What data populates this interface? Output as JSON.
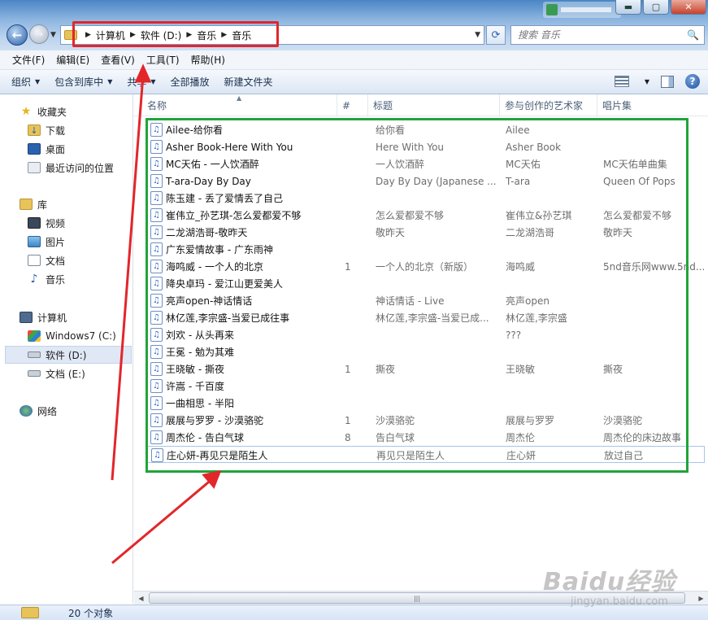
{
  "address_bar": {
    "crumbs": [
      "计算机",
      "软件 (D:)",
      "音乐",
      "音乐"
    ]
  },
  "search": {
    "placeholder": "搜索 音乐"
  },
  "menu": [
    "文件(F)",
    "编辑(E)",
    "查看(V)",
    "工具(T)",
    "帮助(H)"
  ],
  "toolbar": {
    "organize": "组织",
    "include_library": "包含到库中",
    "share": "共享",
    "play_all": "全部播放",
    "new_folder": "新建文件夹"
  },
  "nav": {
    "favorites": "收藏夹",
    "downloads": "下载",
    "desktop": "桌面",
    "recent": "最近访问的位置",
    "libraries": "库",
    "videos": "视频",
    "pictures": "图片",
    "documents": "文档",
    "music": "音乐",
    "computer": "计算机",
    "drive_c": "Windows7 (C:)",
    "drive_d": "软件 (D:)",
    "drive_e": "文档 (E:)",
    "network": "网络"
  },
  "columns": {
    "name": "名称",
    "number": "#",
    "title": "标题",
    "artist": "参与创作的艺术家",
    "album": "唱片集"
  },
  "files": [
    {
      "name": "Ailee-给你看",
      "num": "",
      "title": "给你看",
      "artist": "Ailee",
      "album": ""
    },
    {
      "name": "Asher Book-Here With You",
      "num": "",
      "title": "Here With You",
      "artist": "Asher Book",
      "album": ""
    },
    {
      "name": "MC天佑 - 一人饮酒醉",
      "num": "",
      "title": "一人饮酒醉",
      "artist": "MC天佑",
      "album": "MC天佑单曲集"
    },
    {
      "name": "T-ara-Day By Day",
      "num": "",
      "title": "Day By Day (Japanese ...",
      "artist": "T-ara",
      "album": "Queen Of Pops"
    },
    {
      "name": "陈玉建 - 丢了爱情丢了自己",
      "num": "",
      "title": "",
      "artist": "",
      "album": ""
    },
    {
      "name": "崔伟立_孙艺琪-怎么爱都爱不够",
      "num": "",
      "title": "怎么爱都爱不够",
      "artist": "崔伟立&孙艺琪",
      "album": "怎么爱都爱不够"
    },
    {
      "name": "二龙湖浩哥-敬昨天",
      "num": "",
      "title": "敬昨天",
      "artist": "二龙湖浩哥",
      "album": "敬昨天"
    },
    {
      "name": "广东爱情故事 - 广东雨神",
      "num": "",
      "title": "",
      "artist": "",
      "album": ""
    },
    {
      "name": "海鸣威 - 一个人的北京",
      "num": "1",
      "title": "一个人的北京（新版）",
      "artist": "海鸣威",
      "album": "5nd音乐网www.5nd...."
    },
    {
      "name": "降央卓玛 - 爱江山更爱美人",
      "num": "",
      "title": "",
      "artist": "",
      "album": ""
    },
    {
      "name": "亮声open-神话情话",
      "num": "",
      "title": "神话情话 - Live",
      "artist": "亮声open",
      "album": ""
    },
    {
      "name": "林亿莲,李宗盛-当爱已成往事",
      "num": "",
      "title": "林亿莲,李宗盛-当爱已成...",
      "artist": "林亿莲,李宗盛",
      "album": ""
    },
    {
      "name": "刘欢 - 从头再来",
      "num": "",
      "title": "",
      "artist": "???",
      "album": ""
    },
    {
      "name": "王冕 - 勉为其难",
      "num": "",
      "title": "",
      "artist": "",
      "album": ""
    },
    {
      "name": "王晓敏 - 撕夜",
      "num": "1",
      "title": "撕夜",
      "artist": "王晓敏",
      "album": "撕夜"
    },
    {
      "name": "许嵩 - 千百度",
      "num": "",
      "title": "",
      "artist": "",
      "album": ""
    },
    {
      "name": "一曲相思 - 半阳",
      "num": "",
      "title": "",
      "artist": "",
      "album": ""
    },
    {
      "name": "展展与罗罗 - 沙漠骆驼",
      "num": "1",
      "title": "沙漠骆驼",
      "artist": "展展与罗罗",
      "album": "沙漠骆驼"
    },
    {
      "name": "周杰伦 - 告白气球",
      "num": "8",
      "title": "告白气球",
      "artist": "周杰伦",
      "album": "周杰伦的床边故事"
    },
    {
      "name": "庄心妍-再见只是陌生人",
      "num": "",
      "title": "再见只是陌生人",
      "artist": "庄心妍",
      "album": "放过自己"
    }
  ],
  "status": {
    "count": "20 个对象"
  },
  "watermark": {
    "logo": "Baidu经验",
    "sub": "jingyan.baidu.com"
  },
  "colors": {
    "highlight_red": "#e2262a",
    "highlight_green": "#21a43a",
    "arrow_red": "#e2262a"
  }
}
